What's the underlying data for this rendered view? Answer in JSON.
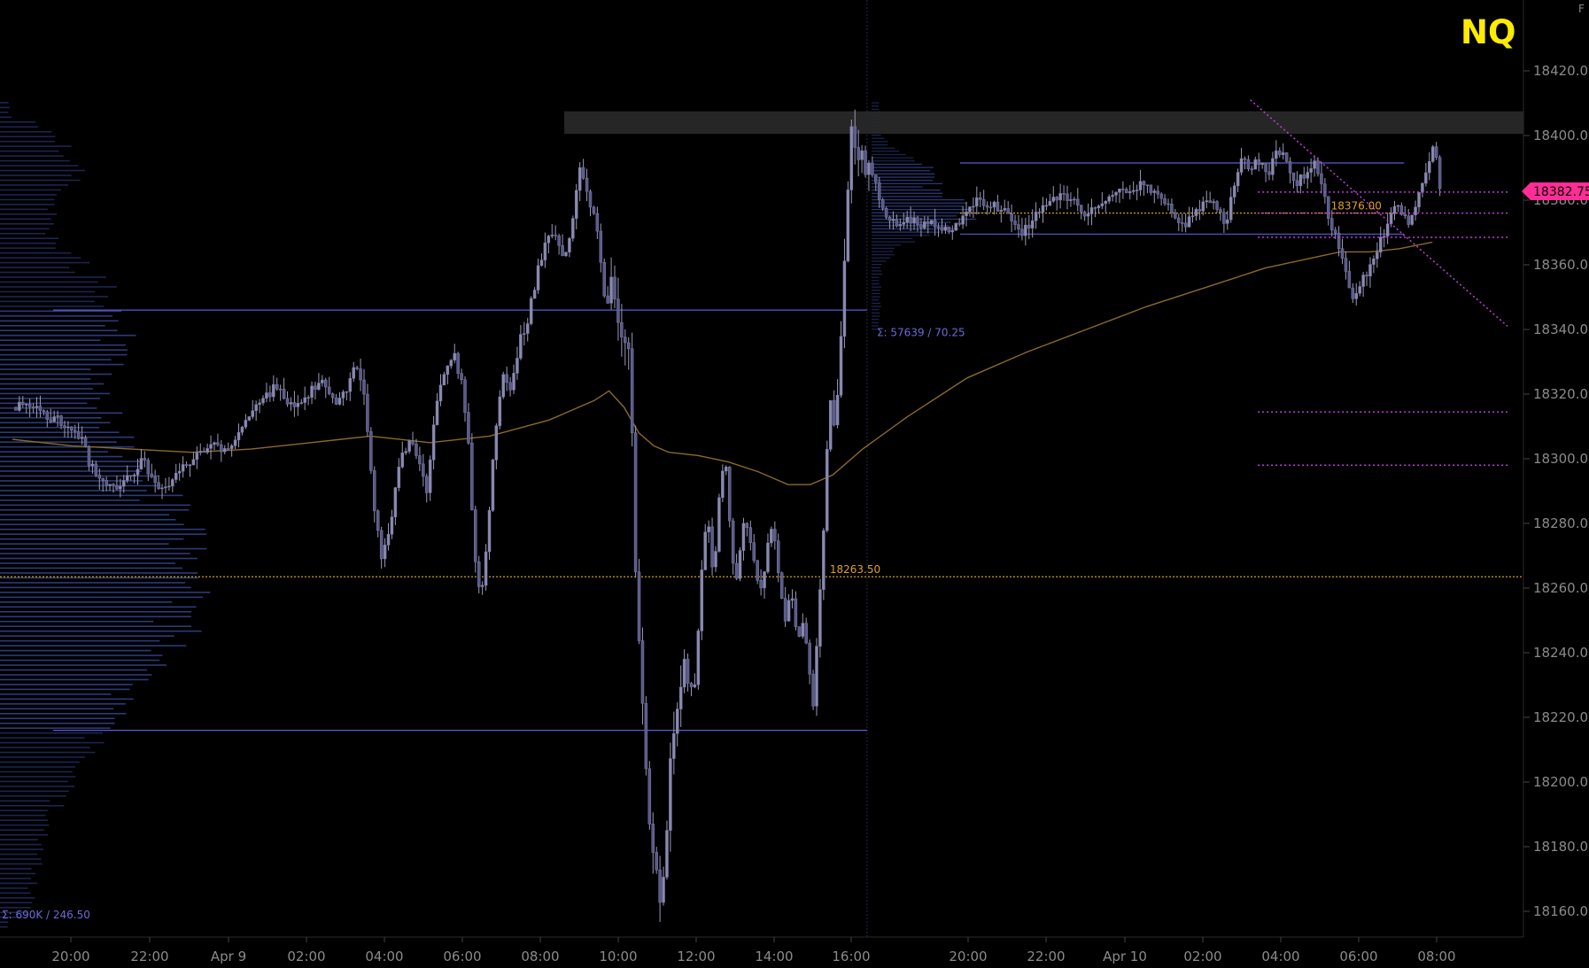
{
  "chart_data": {
    "type": "candlestick",
    "symbol": "NQ",
    "ylim": [
      18150,
      18430
    ],
    "y_ticks": [
      18160,
      18180,
      18200,
      18220,
      18240,
      18260,
      18280,
      18300,
      18320,
      18340,
      18360,
      18380,
      18400,
      18420
    ],
    "x_ticks": [
      "20:00",
      "22:00",
      "Apr 9",
      "02:00",
      "04:00",
      "06:00",
      "08:00",
      "10:00",
      "12:00",
      "14:00",
      "16:00",
      "20:00",
      "22:00",
      "Apr 10",
      "02:00",
      "04:00",
      "06:00",
      "08:00"
    ],
    "last_price": "18382.75",
    "last_price_value": 18382.75,
    "right_edge_label": "F",
    "levels": [
      {
        "value": 18346,
        "color": "#5b5bd6",
        "range": "previous",
        "kind": "value-area-high"
      },
      {
        "value": 18216,
        "color": "#5b5bd6",
        "range": "previous",
        "kind": "value-area-low"
      },
      {
        "value": 18263.5,
        "color": "#d4a017",
        "range": "all",
        "kind": "poc"
      },
      {
        "value": 18391.5,
        "color": "#5b5bd6",
        "range": "current",
        "kind": "value-area-high"
      },
      {
        "value": 18369.5,
        "color": "#5b5bd6",
        "range": "current",
        "kind": "value-area-low"
      },
      {
        "value": 18376,
        "color": "#d4a017",
        "range": "current",
        "kind": "poc"
      }
    ],
    "resistance_zone": [
      18400.5,
      18407.5
    ],
    "magenta_levels": [
      18382.5,
      18376,
      18368.5,
      18314.5,
      18298
    ],
    "trendline": [
      {
        "t": 0.83,
        "y": 18411
      },
      {
        "t": 0.948,
        "y": 18341
      }
    ],
    "annotations": {
      "poc_prev_label": "18263.50",
      "poc_current_label": "18376.00",
      "profile_prev_stats": "Σ: 690K / 246.50",
      "profile_current_stats": "Σ: 57639 / 70.25"
    },
    "price_path": [
      [
        0.0,
        18316
      ],
      [
        0.01,
        18318
      ],
      [
        0.02,
        18314
      ],
      [
        0.03,
        18312
      ],
      [
        0.04,
        18309
      ],
      [
        0.047,
        18306
      ],
      [
        0.052,
        18298
      ],
      [
        0.06,
        18293
      ],
      [
        0.07,
        18291
      ],
      [
        0.078,
        18294
      ],
      [
        0.088,
        18300
      ],
      [
        0.097,
        18290
      ],
      [
        0.105,
        18293
      ],
      [
        0.115,
        18298
      ],
      [
        0.125,
        18301
      ],
      [
        0.135,
        18304
      ],
      [
        0.145,
        18302
      ],
      [
        0.153,
        18308
      ],
      [
        0.16,
        18314
      ],
      [
        0.168,
        18318
      ],
      [
        0.176,
        18322
      ],
      [
        0.184,
        18318
      ],
      [
        0.192,
        18316
      ],
      [
        0.2,
        18321
      ],
      [
        0.208,
        18324
      ],
      [
        0.216,
        18317
      ],
      [
        0.224,
        18322
      ],
      [
        0.23,
        18330
      ],
      [
        0.236,
        18320
      ],
      [
        0.242,
        18286
      ],
      [
        0.248,
        18268
      ],
      [
        0.254,
        18282
      ],
      [
        0.26,
        18300
      ],
      [
        0.266,
        18306
      ],
      [
        0.272,
        18300
      ],
      [
        0.278,
        18290
      ],
      [
        0.284,
        18318
      ],
      [
        0.29,
        18328
      ],
      [
        0.296,
        18332
      ],
      [
        0.302,
        18322
      ],
      [
        0.306,
        18304
      ],
      [
        0.31,
        18268
      ],
      [
        0.314,
        18256
      ],
      [
        0.318,
        18272
      ],
      [
        0.322,
        18298
      ],
      [
        0.328,
        18326
      ],
      [
        0.334,
        18322
      ],
      [
        0.34,
        18336
      ],
      [
        0.346,
        18344
      ],
      [
        0.352,
        18358
      ],
      [
        0.358,
        18368
      ],
      [
        0.364,
        18368
      ],
      [
        0.37,
        18360
      ],
      [
        0.376,
        18375
      ],
      [
        0.38,
        18392
      ],
      [
        0.386,
        18380
      ],
      [
        0.392,
        18372
      ],
      [
        0.398,
        18345
      ],
      [
        0.402,
        18358
      ],
      [
        0.406,
        18344
      ],
      [
        0.41,
        18336
      ],
      [
        0.414,
        18332
      ],
      [
        0.418,
        18262
      ],
      [
        0.422,
        18232
      ],
      [
        0.426,
        18193
      ],
      [
        0.43,
        18175
      ],
      [
        0.434,
        18165
      ],
      [
        0.438,
        18178
      ],
      [
        0.442,
        18212
      ],
      [
        0.446,
        18222
      ],
      [
        0.45,
        18240
      ],
      [
        0.454,
        18228
      ],
      [
        0.458,
        18232
      ],
      [
        0.462,
        18264
      ],
      [
        0.466,
        18284
      ],
      [
        0.47,
        18262
      ],
      [
        0.474,
        18290
      ],
      [
        0.478,
        18300
      ],
      [
        0.482,
        18272
      ],
      [
        0.486,
        18262
      ],
      [
        0.49,
        18280
      ],
      [
        0.494,
        18278
      ],
      [
        0.498,
        18265
      ],
      [
        0.502,
        18260
      ],
      [
        0.506,
        18272
      ],
      [
        0.51,
        18280
      ],
      [
        0.514,
        18262
      ],
      [
        0.518,
        18248
      ],
      [
        0.522,
        18262
      ],
      [
        0.526,
        18244
      ],
      [
        0.53,
        18250
      ],
      [
        0.534,
        18236
      ],
      [
        0.537,
        18222
      ],
      [
        0.54,
        18248
      ],
      [
        0.544,
        18280
      ],
      [
        0.548,
        18320
      ],
      [
        0.552,
        18310
      ],
      [
        0.556,
        18345
      ],
      [
        0.56,
        18382
      ],
      [
        0.562,
        18402
      ],
      [
        0.566,
        18396
      ],
      [
        0.572,
        18390
      ],
      [
        0.578,
        18386
      ],
      [
        0.584,
        18376
      ],
      [
        0.592,
        18373
      ],
      [
        0.6,
        18375
      ],
      [
        0.61,
        18372
      ],
      [
        0.62,
        18373
      ],
      [
        0.63,
        18370
      ],
      [
        0.638,
        18375
      ],
      [
        0.646,
        18380
      ],
      [
        0.654,
        18378
      ],
      [
        0.662,
        18378
      ],
      [
        0.67,
        18373
      ],
      [
        0.678,
        18370
      ],
      [
        0.686,
        18376
      ],
      [
        0.694,
        18378
      ],
      [
        0.702,
        18382
      ],
      [
        0.71,
        18380
      ],
      [
        0.718,
        18376
      ],
      [
        0.726,
        18378
      ],
      [
        0.734,
        18380
      ],
      [
        0.742,
        18384
      ],
      [
        0.75,
        18382
      ],
      [
        0.758,
        18386
      ],
      [
        0.766,
        18382
      ],
      [
        0.774,
        18380
      ],
      [
        0.78,
        18375
      ],
      [
        0.786,
        18372
      ],
      [
        0.794,
        18376
      ],
      [
        0.802,
        18380
      ],
      [
        0.808,
        18378
      ],
      [
        0.814,
        18372
      ],
      [
        0.818,
        18384
      ],
      [
        0.824,
        18392
      ],
      [
        0.83,
        18390
      ],
      [
        0.836,
        18392
      ],
      [
        0.842,
        18388
      ],
      [
        0.848,
        18396
      ],
      [
        0.854,
        18392
      ],
      [
        0.86,
        18384
      ],
      [
        0.866,
        18388
      ],
      [
        0.872,
        18392
      ],
      [
        0.878,
        18384
      ],
      [
        0.884,
        18372
      ],
      [
        0.888,
        18368
      ],
      [
        0.892,
        18362
      ],
      [
        0.896,
        18352
      ],
      [
        0.9,
        18350
      ],
      [
        0.906,
        18356
      ],
      [
        0.912,
        18362
      ],
      [
        0.918,
        18368
      ],
      [
        0.924,
        18376
      ],
      [
        0.93,
        18378
      ],
      [
        0.936,
        18372
      ],
      [
        0.942,
        18380
      ],
      [
        0.946,
        18385
      ],
      [
        0.95,
        18392
      ],
      [
        0.953,
        18398
      ],
      [
        0.957,
        18384
      ]
    ],
    "vwap_path": [
      [
        0.0,
        18306
      ],
      [
        0.04,
        18304
      ],
      [
        0.08,
        18303
      ],
      [
        0.12,
        18302
      ],
      [
        0.16,
        18303
      ],
      [
        0.2,
        18305
      ],
      [
        0.24,
        18307
      ],
      [
        0.28,
        18305
      ],
      [
        0.32,
        18307
      ],
      [
        0.36,
        18312
      ],
      [
        0.39,
        18318
      ],
      [
        0.4,
        18321
      ],
      [
        0.41,
        18316
      ],
      [
        0.42,
        18308
      ],
      [
        0.43,
        18304
      ],
      [
        0.44,
        18302
      ],
      [
        0.46,
        18301
      ],
      [
        0.48,
        18299
      ],
      [
        0.5,
        18296
      ],
      [
        0.52,
        18292
      ],
      [
        0.535,
        18292
      ],
      [
        0.55,
        18295
      ],
      [
        0.57,
        18303
      ],
      [
        0.6,
        18313
      ],
      [
        0.64,
        18325
      ],
      [
        0.68,
        18333
      ],
      [
        0.72,
        18340
      ],
      [
        0.76,
        18347
      ],
      [
        0.8,
        18353
      ],
      [
        0.84,
        18359
      ],
      [
        0.87,
        18362
      ],
      [
        0.89,
        18364
      ],
      [
        0.91,
        18364
      ],
      [
        0.93,
        18365
      ],
      [
        0.952,
        18367
      ]
    ]
  }
}
